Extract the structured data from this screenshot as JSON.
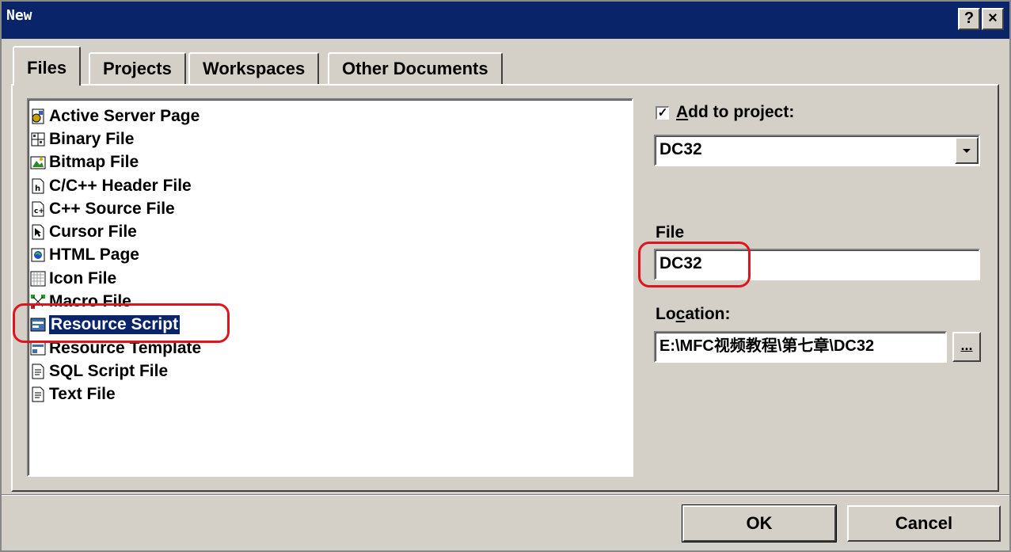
{
  "window": {
    "title": "New",
    "help_label": "?",
    "close_label": "×"
  },
  "tabs": [
    {
      "label": "Files",
      "active": true
    },
    {
      "label": "Projects",
      "active": false
    },
    {
      "label": "Workspaces",
      "active": false
    },
    {
      "label": "Other Documents",
      "active": false
    }
  ],
  "file_types": [
    {
      "label": "Active Server Page",
      "icon": "asp-page-icon"
    },
    {
      "label": "Binary File",
      "icon": "binary-file-icon"
    },
    {
      "label": "Bitmap File",
      "icon": "bitmap-file-icon"
    },
    {
      "label": "C/C++ Header File",
      "icon": "header-file-icon"
    },
    {
      "label": "C++ Source File",
      "icon": "source-file-icon"
    },
    {
      "label": "Cursor File",
      "icon": "cursor-file-icon"
    },
    {
      "label": "HTML Page",
      "icon": "html-page-icon"
    },
    {
      "label": "Icon File",
      "icon": "icon-file-icon"
    },
    {
      "label": "Macro File",
      "icon": "macro-file-icon"
    },
    {
      "label": "Resource Script",
      "icon": "resource-script-icon",
      "selected": true
    },
    {
      "label": "Resource Template",
      "icon": "resource-template-icon"
    },
    {
      "label": "SQL Script File",
      "icon": "sql-file-icon"
    },
    {
      "label": "Text File",
      "icon": "text-file-icon"
    }
  ],
  "add_to_project": {
    "checked": true,
    "check_mark": "✓",
    "label_accel": "A",
    "label_rest": "dd to project:",
    "project_value": "DC32"
  },
  "file_field": {
    "label": "File",
    "value": "DC32"
  },
  "location": {
    "label_pre": "Lo",
    "label_accel": "c",
    "label_post": "ation:",
    "value": "E:\\MFC视频教程\\第七章\\DC32",
    "browse_label": "..."
  },
  "buttons": {
    "ok": "OK",
    "cancel": "Cancel"
  },
  "colors": {
    "titlebar": "#0a246a",
    "face": "#d4d0c8",
    "selection": "#0a246a",
    "annotation": "#e0141e"
  }
}
